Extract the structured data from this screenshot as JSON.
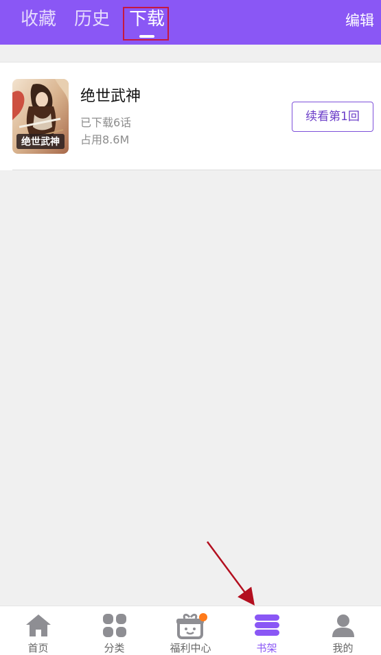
{
  "colors": {
    "brand": "#8a57f5",
    "highlight_box": "#c6183e",
    "arrow": "#b30f1f",
    "nav_active": "#8a57f5",
    "nav_inactive": "#8e8e93",
    "badge": "#ff7a1a"
  },
  "header": {
    "tabs": [
      {
        "label": "收藏",
        "active": false
      },
      {
        "label": "历史",
        "active": false
      },
      {
        "label": "下载",
        "active": true
      }
    ],
    "edit_label": "编辑"
  },
  "downloads": [
    {
      "title": "绝世武神",
      "downloaded": "已下载6话",
      "size": "占用8.6M",
      "action_label": "续看第1回",
      "cover_icon": "comic-cover-image"
    }
  ],
  "bottom_nav": [
    {
      "label": "首页",
      "icon": "home-icon",
      "active": false
    },
    {
      "label": "分类",
      "icon": "category-icon",
      "active": false
    },
    {
      "label": "福利中心",
      "icon": "gift-icon",
      "active": false,
      "badge": true
    },
    {
      "label": "书架",
      "icon": "bookshelf-icon",
      "active": true
    },
    {
      "label": "我的",
      "icon": "profile-icon",
      "active": false
    }
  ]
}
